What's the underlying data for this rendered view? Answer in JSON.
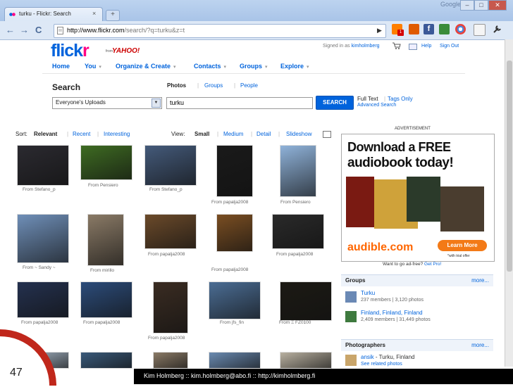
{
  "browser": {
    "tab_title": "turku - Flickr: Search",
    "tab_close": "×",
    "new_tab": "+",
    "brand": "Google",
    "window_buttons": [
      "–",
      "□",
      "✕"
    ],
    "url_host": "http://www.flickr.com",
    "url_path": "/search/?q=turku&z=t",
    "nav_back": "←",
    "nav_forward": "→",
    "nav_reload": "C",
    "nav_home": "☆",
    "extension_badge": "1"
  },
  "header": {
    "logo_part1": "flick",
    "logo_part2": "r",
    "from": "from",
    "yahoo": "YAHOO!",
    "signed_in_prefix": "Signed in as",
    "username": "kimholmberg",
    "help": "Help",
    "sign_out": "Sign Out"
  },
  "nav": {
    "items": [
      {
        "label": "Home",
        "caret": ""
      },
      {
        "label": "You",
        "caret": "▾"
      },
      {
        "label": "Organize & Create",
        "caret": "▾"
      },
      {
        "label": "Contacts",
        "caret": "▾"
      },
      {
        "label": "Groups",
        "caret": "▾"
      },
      {
        "label": "Explore",
        "caret": "▾"
      }
    ]
  },
  "search": {
    "title": "Search",
    "tabs": [
      "Photos",
      "Groups",
      "People"
    ],
    "separator": "|",
    "scope": "Everyone's Uploads",
    "query": "turku",
    "button": "SEARCH",
    "full_text": "Full Text",
    "tags_only": "Tags Only",
    "advanced": "Advanced Search"
  },
  "sort": {
    "label": "Sort:",
    "options": [
      "Relevant",
      "Recent",
      "Interesting"
    ],
    "view_label": "View:",
    "view_options": [
      "Small",
      "Medium",
      "Detail",
      "Slideshow"
    ]
  },
  "photos": [
    {
      "caption": "From Stefano_p",
      "color": "#2b2a30"
    },
    {
      "caption": "From Pensiero",
      "color": "#3e6b22"
    },
    {
      "caption": "From Stefano_p",
      "color": "#445a7a"
    },
    {
      "caption": "From papalja2008",
      "color": "#1a1a1a"
    },
    {
      "caption": "From Pensiero",
      "color": "#8fb2d9"
    },
    {
      "caption": "From ~ Sandy ~",
      "color": "#6f8fb8"
    },
    {
      "caption": "From mirillo",
      "color": "#8a7a66"
    },
    {
      "caption": "From papalja2008",
      "color": "#6b4a2a"
    },
    {
      "caption": "From papalja2008",
      "color": "#7a4e22"
    },
    {
      "caption": "From papalja2008",
      "color": "#2a2a2a"
    },
    {
      "caption": "From papalja2008",
      "color": "#24314f"
    },
    {
      "caption": "From papalja2008",
      "color": "#2c4c7a"
    },
    {
      "caption": "From papalja2008",
      "color": "#3a2c22"
    },
    {
      "caption": "From jfs_fin",
      "color": "#4b6d94"
    },
    {
      "caption": "From Ξ FZ0100",
      "color": "#1c1a14"
    }
  ],
  "ad": {
    "label": "ADVERTISEMENT",
    "headline1": "Download a FREE",
    "headline2": "audiobook today!",
    "brand": "audible.com",
    "cta": "Learn More",
    "fine": "*with trial offer",
    "adfree_text": "Want to go ad-free?",
    "adfree_link": "Get Pro!"
  },
  "groups": {
    "title": "Groups",
    "more": "more...",
    "items": [
      {
        "name": "Turku",
        "stats": "237 members | 3,120 photos"
      },
      {
        "name": "Finland, Finland, Finland",
        "stats": "2,409 members | 31,449 photos"
      }
    ]
  },
  "photographers": {
    "title": "Photographers",
    "more": "more...",
    "items": [
      {
        "name": "ansik",
        "detail": " - Turku, Finland",
        "link": "See related photos"
      }
    ]
  },
  "footer": {
    "slide_number": "47",
    "text": "Kim Holmberg  ::  kim.holmberg@abo.fi  ::  http://kimholmberg.fi"
  }
}
